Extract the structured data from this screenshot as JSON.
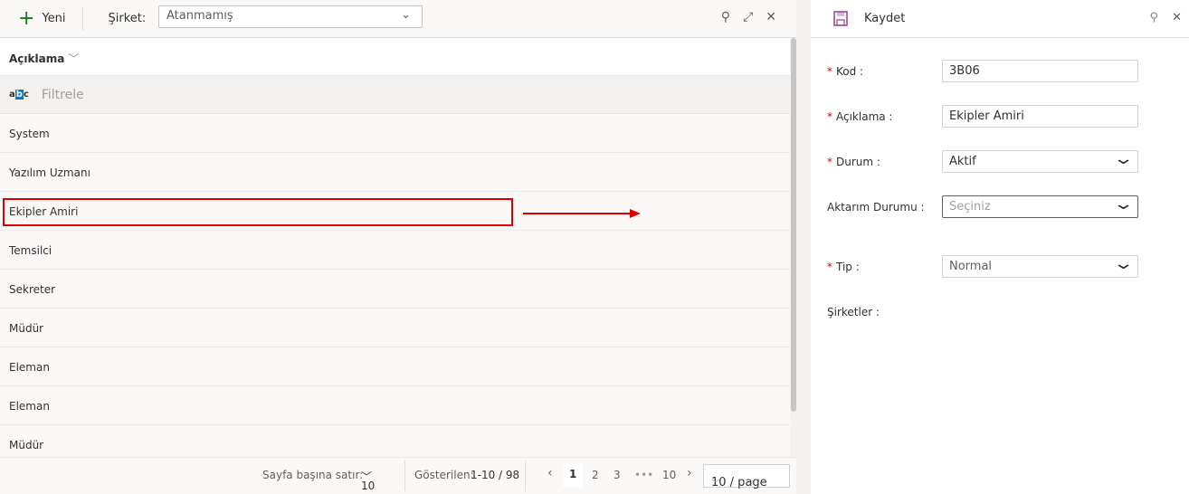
{
  "toolbar": {
    "new_label": "Yeni",
    "company_label": "Şirket:",
    "company_value": "Atanmamış"
  },
  "grid": {
    "column": "Açıklama",
    "filter_placeholder": "Filtrele",
    "filter_icon_text": "abc",
    "rows": [
      "System",
      "Yazılım Uzmanı",
      "Ekipler Amiri",
      "Temsilci",
      "Sekreter",
      "Müdür",
      "Eleman",
      "Eleman",
      "Müdür"
    ],
    "selected_row": "Ekipler Amiri"
  },
  "footer": {
    "rows_per_page_label": "Sayfa başına satır:",
    "rows_per_page": "10",
    "shown_label": "Gösterilen:",
    "shown_value": "1-10 / 98",
    "pages": [
      "1",
      "2",
      "3",
      "•••",
      "10"
    ],
    "current_page": "1",
    "page_size": "10 / page"
  },
  "form": {
    "save_label": "Kaydet",
    "fields": [
      {
        "label": "Kod",
        "value": "3B06",
        "required": true
      },
      {
        "label": "Açıklama",
        "value": "Ekipler Amiri",
        "required": true
      },
      {
        "label": "Durum",
        "value": "Aktif",
        "required": true
      },
      {
        "label": "Aktarım Durumu",
        "value": "Seçiniz",
        "required": false
      },
      {
        "label": "Tip",
        "value": "Normal",
        "required": true
      },
      {
        "label": "Şirketler",
        "required": false
      }
    ]
  },
  "colors": {
    "accent": "#0078d4",
    "highlight": "#e00000",
    "save_icon": "#a4479b",
    "plus": "#107c10"
  }
}
